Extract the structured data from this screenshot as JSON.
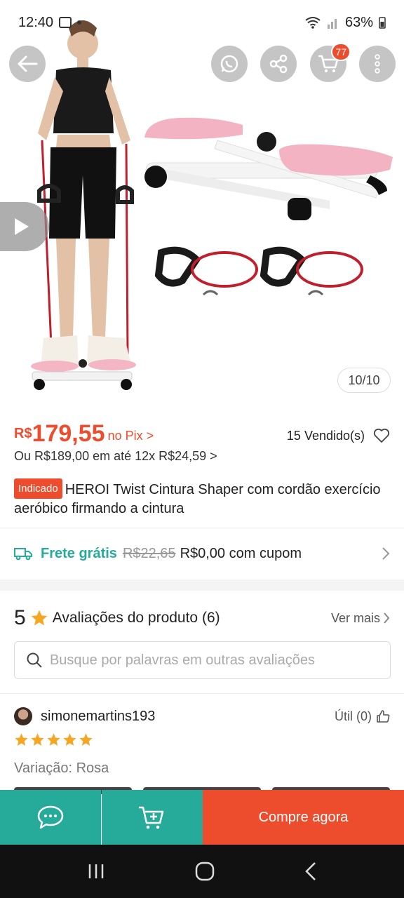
{
  "status_bar": {
    "time": "12:40",
    "battery": "63%"
  },
  "colors": {
    "brand": "#ee4d2d",
    "teal": "#26aa99",
    "star": "#f5a623"
  },
  "gallery": {
    "image_counter": "10/10",
    "cart_badge": "77",
    "icons": [
      "back-arrow-icon",
      "whatsapp-icon",
      "share-icon",
      "cart-icon",
      "more-vertical-icon",
      "play-icon"
    ]
  },
  "price": {
    "currency": "R$",
    "value": "179,55",
    "pix_label": "no Pix >",
    "sold": "15 Vendido(s)",
    "installment": "Ou R$189,00 em até 12x R$24,59 >"
  },
  "product": {
    "badge": "Indicado",
    "title": "HEROI Twist Cintura Shaper com cordão exercício aeróbico firmando a cintura"
  },
  "shipping": {
    "free_label": "Frete grátis",
    "old_price": "R$22,65",
    "new_price": "R$0,00 com cupom"
  },
  "reviews": {
    "score": "5",
    "title": "Avaliações do produto (6)",
    "see_more": "Ver mais",
    "search_placeholder": "Busque por palavras em outras avaliações",
    "first_review": {
      "username": "simonemartins193",
      "helpful": "Útil (0)",
      "stars": 5,
      "variation": "Variação: Rosa"
    }
  },
  "action_bar": {
    "buy_label": "Compre agora"
  }
}
